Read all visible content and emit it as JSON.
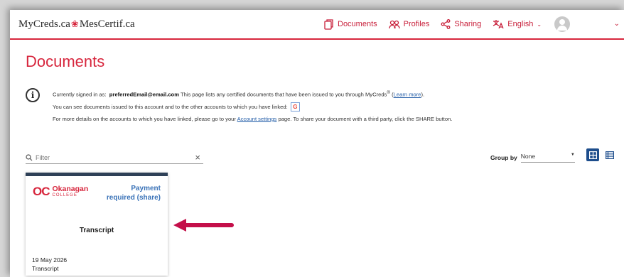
{
  "header": {
    "logo_left": "MyCreds.ca",
    "logo_right": "MesCertif.ca",
    "nav": {
      "documents": "Documents",
      "profiles": "Profiles",
      "sharing": "Sharing",
      "language": "English"
    },
    "accent": "#d7263d"
  },
  "page_title": "Documents",
  "info": {
    "signed_in_prefix": "Currently signed in as:",
    "email": "preferredEmail@email.com",
    "line1_text": "This page lists any certified documents that have been issued to you through MyCreds",
    "registered": "®",
    "learn_more": "Learn more",
    "line2": "You can see documents issued to this account and to the other accounts to which you have linked:",
    "google_badge": "G",
    "line3_before": "For more details on the accounts to which you have linked, please go to your",
    "account_settings": "Account settings",
    "line3_after": "page. To share your document with a third party, click the SHARE button."
  },
  "filter": {
    "placeholder": "Filter"
  },
  "group_by": {
    "label": "Group by",
    "value": "None"
  },
  "card": {
    "institution_mark": "OC",
    "institution_name": "Okanagan",
    "institution_sub": "COLLEGE",
    "status_line1": "Payment",
    "status_line2": "required (share)",
    "title": "Transcript",
    "date": "19 May 2026",
    "type": "Transcript"
  }
}
